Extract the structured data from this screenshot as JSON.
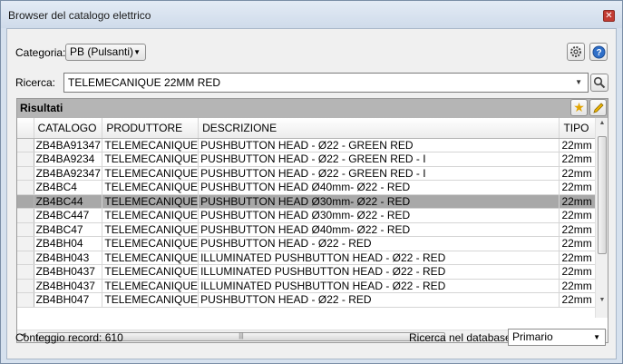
{
  "window": {
    "title": "Browser del catalogo elettrico"
  },
  "category": {
    "label": "Categoria:",
    "value": "PB (Pulsanti)"
  },
  "search": {
    "label": "Ricerca:",
    "value": "TELEMECANIQUE 22MM RED"
  },
  "results": {
    "title": "Risultati",
    "columns": [
      "CATALOGO",
      "PRODUTTORE",
      "DESCRIZIONE",
      "TIPO"
    ],
    "rows": [
      [
        "ZB4BA91347",
        "TELEMECANIQUE",
        "PUSHBUTTON HEAD - Ø22 - GREEN RED",
        "22mm"
      ],
      [
        "ZB4BA9234",
        "TELEMECANIQUE",
        "PUSHBUTTON HEAD - Ø22 - GREEN RED - I",
        "22mm"
      ],
      [
        "ZB4BA92347",
        "TELEMECANIQUE",
        "PUSHBUTTON HEAD - Ø22 - GREEN RED - I",
        "22mm"
      ],
      [
        "ZB4BC4",
        "TELEMECANIQUE",
        "PUSHBUTTON HEAD Ø40mm- Ø22 - RED",
        "22mm"
      ],
      [
        "ZB4BC44",
        "TELEMECANIQUE",
        "PUSHBUTTON HEAD Ø30mm- Ø22 - RED",
        "22mm"
      ],
      [
        "ZB4BC447",
        "TELEMECANIQUE",
        "PUSHBUTTON HEAD Ø30mm- Ø22 - RED",
        "22mm"
      ],
      [
        "ZB4BC47",
        "TELEMECANIQUE",
        "PUSHBUTTON HEAD Ø40mm- Ø22 - RED",
        "22mm"
      ],
      [
        "ZB4BH04",
        "TELEMECANIQUE",
        "PUSHBUTTON HEAD - Ø22 - RED",
        "22mm"
      ],
      [
        "ZB4BH043",
        "TELEMECANIQUE",
        "ILLUMINATED PUSHBUTTON HEAD - Ø22 - RED",
        "22mm"
      ],
      [
        "ZB4BH0437",
        "TELEMECANIQUE",
        "ILLUMINATED PUSHBUTTON HEAD - Ø22 - RED",
        "22mm"
      ],
      [
        "ZB4BH0437",
        "TELEMECANIQUE",
        "ILLUMINATED PUSHBUTTON HEAD - Ø22 - RED",
        "22mm"
      ],
      [
        "ZB4BH047",
        "TELEMECANIQUE",
        "PUSHBUTTON HEAD - Ø22 - RED",
        "22mm"
      ]
    ],
    "selected_row": 4
  },
  "footer": {
    "record_count": "Conteggio record: 610",
    "db_label": "Ricerca nel database:",
    "db_value": "Primario"
  }
}
